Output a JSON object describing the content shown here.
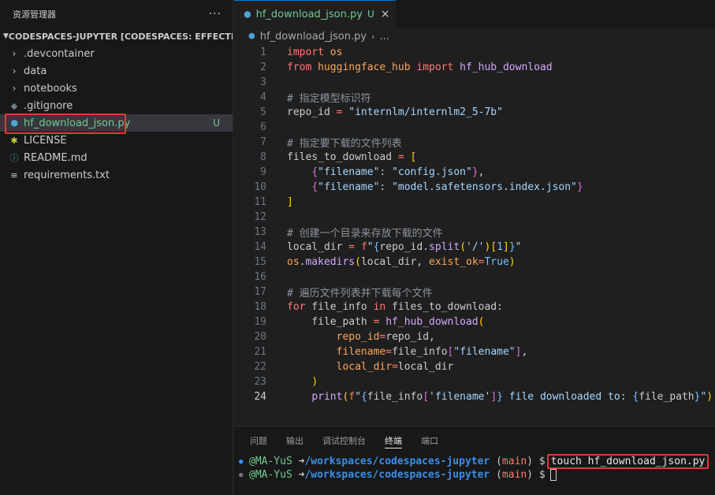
{
  "sidebar": {
    "title": "资源管理器",
    "more": "···",
    "section_title": "CODESPACES-JUPYTER [CODESPACES: EFFECTIVE P...",
    "items": [
      {
        "label": ".devcontainer",
        "type": "folder"
      },
      {
        "label": "data",
        "type": "folder"
      },
      {
        "label": "notebooks",
        "type": "folder"
      },
      {
        "label": ".gitignore",
        "type": "gitignore"
      },
      {
        "label": "hf_download_json.py",
        "type": "python",
        "badge": "U",
        "selected": true
      },
      {
        "label": "LICENSE",
        "type": "license"
      },
      {
        "label": "README.md",
        "type": "info"
      },
      {
        "label": "requirements.txt",
        "type": "text"
      }
    ]
  },
  "editor": {
    "tab": {
      "name": "hf_download_json.py",
      "badge": "U",
      "close": "×"
    },
    "breadcrumb": {
      "file": "hf_download_json.py",
      "rest": "..."
    },
    "active_line": 24,
    "line_numbers": [
      "1",
      "2",
      "3",
      "4",
      "5",
      "6",
      "7",
      "8",
      "9",
      "10",
      "11",
      "12",
      "13",
      "14",
      "15",
      "16",
      "17",
      "18",
      "19",
      "20",
      "21",
      "22",
      "23",
      "24"
    ]
  },
  "panel": {
    "tabs": [
      "问题",
      "输出",
      "调试控制台",
      "终端",
      "端口"
    ],
    "active_tab": "终端",
    "terminal": [
      {
        "user": "@MA-YuS",
        "arrow": "➜",
        "path": "/workspaces/codespaces-jupyter",
        "branch_open": "(",
        "branch": "main",
        "branch_close": ")",
        "prompt": "$",
        "command": "touch hf_download_json.py"
      },
      {
        "user": "@MA-YuS",
        "arrow": "➜",
        "path": "/workspaces/codespaces-jupyter",
        "branch_open": "(",
        "branch": "main",
        "branch_close": ")",
        "prompt": "$",
        "command": ""
      }
    ]
  },
  "colors": {
    "accent": "#0078d4",
    "untracked": "#73c991",
    "highlight_box": "#e03b3b"
  }
}
